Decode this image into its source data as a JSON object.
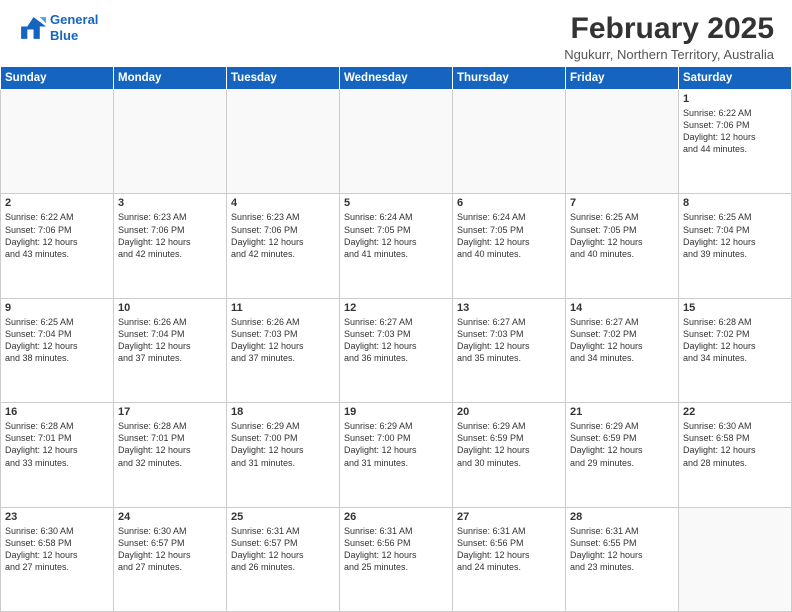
{
  "header": {
    "logo_line1": "General",
    "logo_line2": "Blue",
    "month": "February 2025",
    "location": "Ngukurr, Northern Territory, Australia"
  },
  "days_of_week": [
    "Sunday",
    "Monday",
    "Tuesday",
    "Wednesday",
    "Thursday",
    "Friday",
    "Saturday"
  ],
  "weeks": [
    [
      {
        "day": "",
        "info": ""
      },
      {
        "day": "",
        "info": ""
      },
      {
        "day": "",
        "info": ""
      },
      {
        "day": "",
        "info": ""
      },
      {
        "day": "",
        "info": ""
      },
      {
        "day": "",
        "info": ""
      },
      {
        "day": "1",
        "info": "Sunrise: 6:22 AM\nSunset: 7:06 PM\nDaylight: 12 hours\nand 44 minutes."
      }
    ],
    [
      {
        "day": "2",
        "info": "Sunrise: 6:22 AM\nSunset: 7:06 PM\nDaylight: 12 hours\nand 43 minutes."
      },
      {
        "day": "3",
        "info": "Sunrise: 6:23 AM\nSunset: 7:06 PM\nDaylight: 12 hours\nand 42 minutes."
      },
      {
        "day": "4",
        "info": "Sunrise: 6:23 AM\nSunset: 7:06 PM\nDaylight: 12 hours\nand 42 minutes."
      },
      {
        "day": "5",
        "info": "Sunrise: 6:24 AM\nSunset: 7:05 PM\nDaylight: 12 hours\nand 41 minutes."
      },
      {
        "day": "6",
        "info": "Sunrise: 6:24 AM\nSunset: 7:05 PM\nDaylight: 12 hours\nand 40 minutes."
      },
      {
        "day": "7",
        "info": "Sunrise: 6:25 AM\nSunset: 7:05 PM\nDaylight: 12 hours\nand 40 minutes."
      },
      {
        "day": "8",
        "info": "Sunrise: 6:25 AM\nSunset: 7:04 PM\nDaylight: 12 hours\nand 39 minutes."
      }
    ],
    [
      {
        "day": "9",
        "info": "Sunrise: 6:25 AM\nSunset: 7:04 PM\nDaylight: 12 hours\nand 38 minutes."
      },
      {
        "day": "10",
        "info": "Sunrise: 6:26 AM\nSunset: 7:04 PM\nDaylight: 12 hours\nand 37 minutes."
      },
      {
        "day": "11",
        "info": "Sunrise: 6:26 AM\nSunset: 7:03 PM\nDaylight: 12 hours\nand 37 minutes."
      },
      {
        "day": "12",
        "info": "Sunrise: 6:27 AM\nSunset: 7:03 PM\nDaylight: 12 hours\nand 36 minutes."
      },
      {
        "day": "13",
        "info": "Sunrise: 6:27 AM\nSunset: 7:03 PM\nDaylight: 12 hours\nand 35 minutes."
      },
      {
        "day": "14",
        "info": "Sunrise: 6:27 AM\nSunset: 7:02 PM\nDaylight: 12 hours\nand 34 minutes."
      },
      {
        "day": "15",
        "info": "Sunrise: 6:28 AM\nSunset: 7:02 PM\nDaylight: 12 hours\nand 34 minutes."
      }
    ],
    [
      {
        "day": "16",
        "info": "Sunrise: 6:28 AM\nSunset: 7:01 PM\nDaylight: 12 hours\nand 33 minutes."
      },
      {
        "day": "17",
        "info": "Sunrise: 6:28 AM\nSunset: 7:01 PM\nDaylight: 12 hours\nand 32 minutes."
      },
      {
        "day": "18",
        "info": "Sunrise: 6:29 AM\nSunset: 7:00 PM\nDaylight: 12 hours\nand 31 minutes."
      },
      {
        "day": "19",
        "info": "Sunrise: 6:29 AM\nSunset: 7:00 PM\nDaylight: 12 hours\nand 31 minutes."
      },
      {
        "day": "20",
        "info": "Sunrise: 6:29 AM\nSunset: 6:59 PM\nDaylight: 12 hours\nand 30 minutes."
      },
      {
        "day": "21",
        "info": "Sunrise: 6:29 AM\nSunset: 6:59 PM\nDaylight: 12 hours\nand 29 minutes."
      },
      {
        "day": "22",
        "info": "Sunrise: 6:30 AM\nSunset: 6:58 PM\nDaylight: 12 hours\nand 28 minutes."
      }
    ],
    [
      {
        "day": "23",
        "info": "Sunrise: 6:30 AM\nSunset: 6:58 PM\nDaylight: 12 hours\nand 27 minutes."
      },
      {
        "day": "24",
        "info": "Sunrise: 6:30 AM\nSunset: 6:57 PM\nDaylight: 12 hours\nand 27 minutes."
      },
      {
        "day": "25",
        "info": "Sunrise: 6:31 AM\nSunset: 6:57 PM\nDaylight: 12 hours\nand 26 minutes."
      },
      {
        "day": "26",
        "info": "Sunrise: 6:31 AM\nSunset: 6:56 PM\nDaylight: 12 hours\nand 25 minutes."
      },
      {
        "day": "27",
        "info": "Sunrise: 6:31 AM\nSunset: 6:56 PM\nDaylight: 12 hours\nand 24 minutes."
      },
      {
        "day": "28",
        "info": "Sunrise: 6:31 AM\nSunset: 6:55 PM\nDaylight: 12 hours\nand 23 minutes."
      },
      {
        "day": "",
        "info": ""
      }
    ]
  ]
}
